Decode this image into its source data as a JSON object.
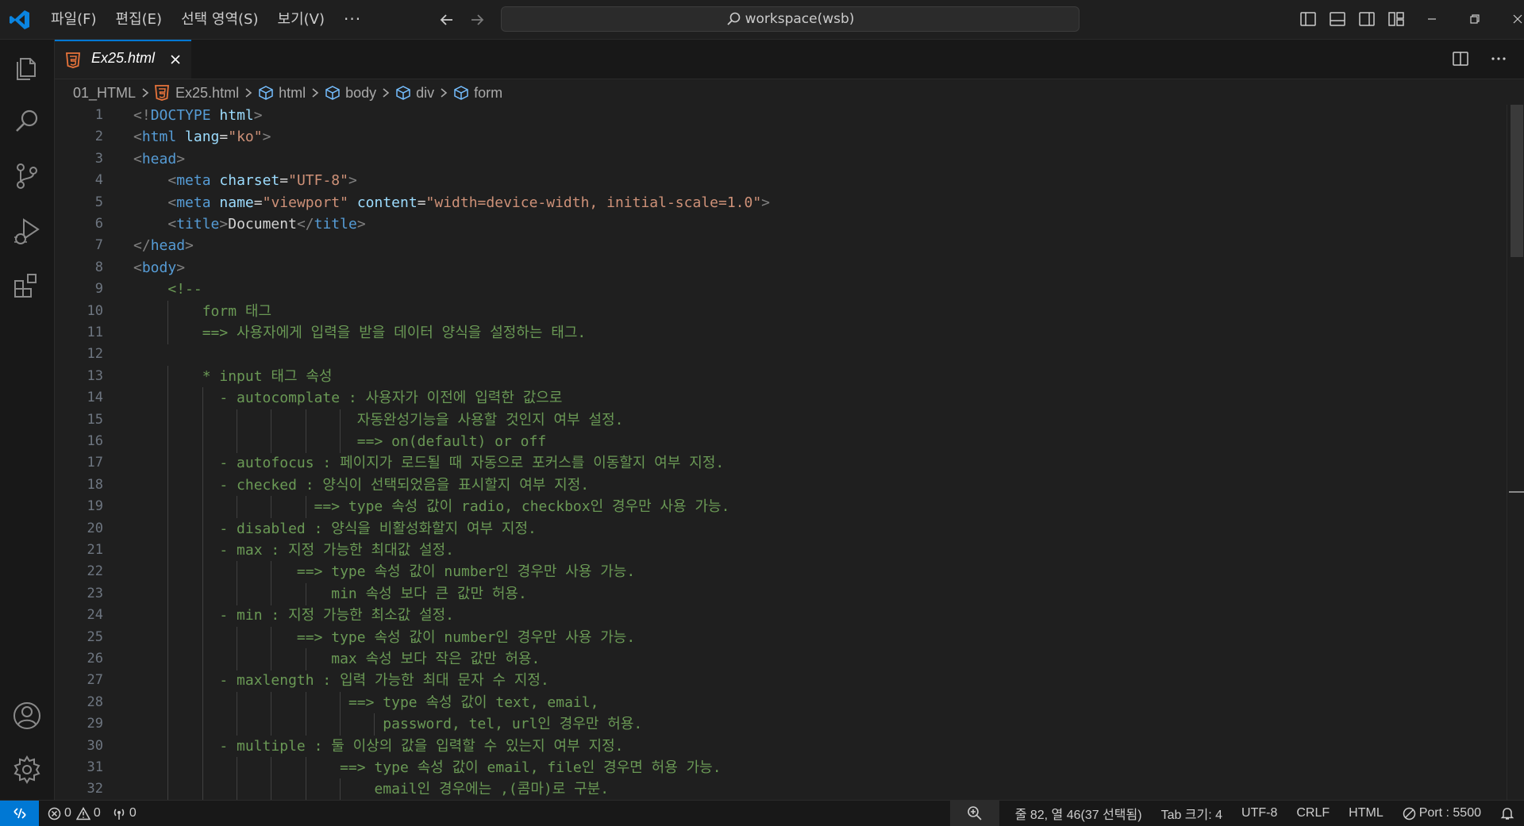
{
  "titlebar": {
    "menu": [
      "파일(F)",
      "편집(E)",
      "선택 영역(S)",
      "보기(V)"
    ],
    "more": "···",
    "search_label": "workspace(wsb)"
  },
  "tab": {
    "title": "Ex25.html"
  },
  "breadcrumb": {
    "folder": "01_HTML",
    "file": "Ex25.html",
    "symbols": [
      "html",
      "body",
      "div",
      "form"
    ]
  },
  "editor": {
    "line_numbers": [
      "1",
      "2",
      "3",
      "4",
      "5",
      "6",
      "7",
      "8",
      "9",
      "10",
      "11",
      "12",
      "13",
      "14",
      "15",
      "16",
      "17",
      "18",
      "19",
      "20",
      "21",
      "22",
      "23",
      "24",
      "25",
      "26",
      "27",
      "28",
      "29",
      "30",
      "31",
      "32"
    ],
    "lines": [
      [
        [
          "p",
          "<!"
        ],
        [
          "t",
          "DOCTYPE"
        ],
        [
          "x",
          " "
        ],
        [
          "a",
          "html"
        ],
        [
          "p",
          ">"
        ]
      ],
      [
        [
          "p",
          "<"
        ],
        [
          "t",
          "html"
        ],
        [
          "x",
          " "
        ],
        [
          "a",
          "lang"
        ],
        [
          "x",
          "="
        ],
        [
          "s",
          "\"ko\""
        ],
        [
          "p",
          ">"
        ]
      ],
      [
        [
          "p",
          "<"
        ],
        [
          "t",
          "head"
        ],
        [
          "p",
          ">"
        ]
      ],
      [
        [
          "x",
          "    "
        ],
        [
          "p",
          "<"
        ],
        [
          "t",
          "meta"
        ],
        [
          "x",
          " "
        ],
        [
          "a",
          "charset"
        ],
        [
          "x",
          "="
        ],
        [
          "s",
          "\"UTF-8\""
        ],
        [
          "p",
          ">"
        ]
      ],
      [
        [
          "x",
          "    "
        ],
        [
          "p",
          "<"
        ],
        [
          "t",
          "meta"
        ],
        [
          "x",
          " "
        ],
        [
          "a",
          "name"
        ],
        [
          "x",
          "="
        ],
        [
          "s",
          "\"viewport\""
        ],
        [
          "x",
          " "
        ],
        [
          "a",
          "content"
        ],
        [
          "x",
          "="
        ],
        [
          "s",
          "\"width=device-width, initial-scale=1.0\""
        ],
        [
          "p",
          ">"
        ]
      ],
      [
        [
          "x",
          "    "
        ],
        [
          "p",
          "<"
        ],
        [
          "t",
          "title"
        ],
        [
          "p",
          ">"
        ],
        [
          "x",
          "Document"
        ],
        [
          "p",
          "</"
        ],
        [
          "t",
          "title"
        ],
        [
          "p",
          ">"
        ]
      ],
      [
        [
          "p",
          "</"
        ],
        [
          "t",
          "head"
        ],
        [
          "p",
          ">"
        ]
      ],
      [
        [
          "p",
          "<"
        ],
        [
          "t",
          "body"
        ],
        [
          "p",
          ">"
        ]
      ],
      [
        [
          "x",
          "    "
        ],
        [
          "c",
          "<!--"
        ]
      ],
      [
        [
          "x",
          "        "
        ],
        [
          "c",
          "form 태그"
        ]
      ],
      [
        [
          "x",
          "        "
        ],
        [
          "c",
          "==> 사용자에게 입력을 받을 데이터 양식을 설정하는 태그."
        ]
      ],
      [
        [
          "x",
          ""
        ]
      ],
      [
        [
          "x",
          "        "
        ],
        [
          "c",
          "* input 태그 속성"
        ]
      ],
      [
        [
          "x",
          "          "
        ],
        [
          "c",
          "- autocomplate : 사용자가 이전에 입력한 값으로"
        ]
      ],
      [
        [
          "x",
          "                          "
        ],
        [
          "c",
          "자동완성기능을 사용할 것인지 여부 설정."
        ]
      ],
      [
        [
          "x",
          "                          "
        ],
        [
          "c",
          "==> on(default) or off"
        ]
      ],
      [
        [
          "x",
          "          "
        ],
        [
          "c",
          "- autofocus : 페이지가 로드될 때 자동으로 포커스를 이동할지 여부 지정."
        ]
      ],
      [
        [
          "x",
          "          "
        ],
        [
          "c",
          "- checked : 양식이 선택되었음을 표시할지 여부 지정."
        ]
      ],
      [
        [
          "x",
          "                     "
        ],
        [
          "c",
          "==> type 속성 값이 radio, checkbox인 경우만 사용 가능."
        ]
      ],
      [
        [
          "x",
          "          "
        ],
        [
          "c",
          "- disabled : 양식을 비활성화할지 여부 지정."
        ]
      ],
      [
        [
          "x",
          "          "
        ],
        [
          "c",
          "- max : 지정 가능한 최대값 설정."
        ]
      ],
      [
        [
          "x",
          "                   "
        ],
        [
          "c",
          "==> type 속성 값이 number인 경우만 사용 가능."
        ]
      ],
      [
        [
          "x",
          "                       "
        ],
        [
          "c",
          "min 속성 보다 큰 값만 허용."
        ]
      ],
      [
        [
          "x",
          "          "
        ],
        [
          "c",
          "- min : 지정 가능한 최소값 설정."
        ]
      ],
      [
        [
          "x",
          "                   "
        ],
        [
          "c",
          "==> type 속성 값이 number인 경우만 사용 가능."
        ]
      ],
      [
        [
          "x",
          "                       "
        ],
        [
          "c",
          "max 속성 보다 작은 값만 허용."
        ]
      ],
      [
        [
          "x",
          "          "
        ],
        [
          "c",
          "- maxlength : 입력 가능한 최대 문자 수 지정."
        ]
      ],
      [
        [
          "x",
          "                         "
        ],
        [
          "c",
          "==> type 속성 값이 text, email,"
        ]
      ],
      [
        [
          "x",
          "                             "
        ],
        [
          "c",
          "password, tel, url인 경우만 허용."
        ]
      ],
      [
        [
          "x",
          "          "
        ],
        [
          "c",
          "- multiple : 둘 이상의 값을 입력할 수 있는지 여부 지정."
        ]
      ],
      [
        [
          "x",
          "                        "
        ],
        [
          "c",
          "==> type 속성 값이 email, file인 경우면 허용 가능."
        ]
      ],
      [
        [
          "x",
          "                            "
        ],
        [
          "c",
          "email인 경우에는 ,(콤마)로 구분."
        ]
      ]
    ]
  },
  "status": {
    "errors": "0",
    "warnings": "0",
    "ports_forwarded": "0",
    "cursor": "줄 82, 열 46(37 선택됨)",
    "tab_size": "Tab 크기: 4",
    "encoding": "UTF-8",
    "eol": "CRLF",
    "language": "HTML",
    "port": "Port : 5500"
  },
  "colors": {
    "accent": "#0078d4",
    "html_icon": "#e8743b",
    "tag": "#569cd6",
    "attribute": "#9cdcfe",
    "string": "#ce9178",
    "comment": "#6a9955"
  },
  "icons": {
    "activity": [
      "files-icon",
      "search-icon",
      "source-control-icon",
      "run-debug-icon",
      "extensions-icon",
      "account-icon",
      "settings-gear-icon"
    ]
  }
}
